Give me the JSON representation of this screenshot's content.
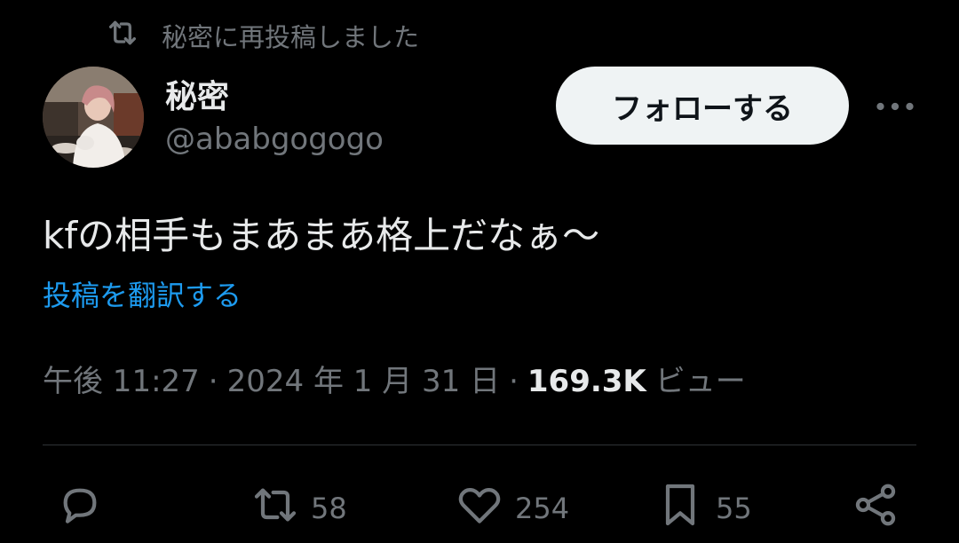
{
  "repost": {
    "label": "秘密に再投稿しました",
    "icon": "repost-icon"
  },
  "author": {
    "display_name": "秘密",
    "handle": "@ababgogogo",
    "avatar": "avatar-photo"
  },
  "follow_button": {
    "label": "フォローする"
  },
  "post": {
    "text": "kfの相手もまあまあ格上だなぁ〜",
    "translate_label": "投稿を翻訳する"
  },
  "meta": {
    "time": "午後 11:27",
    "separator": "·",
    "date": "2024 年 1 月 31 日",
    "views_count": "169.3K",
    "views_label": "ビュー"
  },
  "actions": {
    "reply": {
      "icon": "reply-icon"
    },
    "repost": {
      "icon": "repost-icon",
      "count": "58"
    },
    "like": {
      "icon": "heart-icon",
      "count": "254"
    },
    "bookmark": {
      "icon": "bookmark-icon",
      "count": "55"
    },
    "share": {
      "icon": "share-icon"
    }
  },
  "colors": {
    "background": "#000000",
    "primary_text": "#e7e9ea",
    "secondary_text": "#71767b",
    "link": "#1d9bf0",
    "follow_button_bg": "#eff3f4",
    "divider": "#2f3336"
  }
}
